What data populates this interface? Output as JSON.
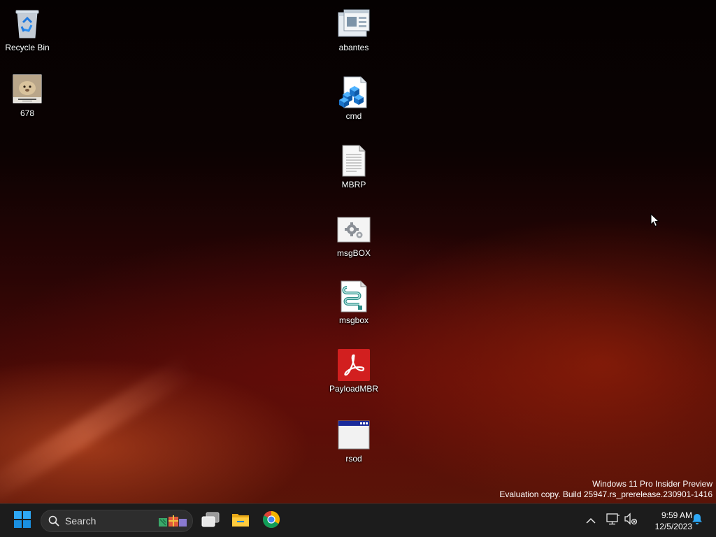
{
  "desktop": {
    "icons": [
      {
        "label": "Recycle Bin",
        "icon": "recycle-bin-icon"
      },
      {
        "label": "678",
        "icon": "image-file-icon"
      },
      {
        "label": "abantes",
        "icon": "application-window-icon"
      },
      {
        "label": "cmd",
        "icon": "registry-cubes-icon"
      },
      {
        "label": "MBRP",
        "icon": "text-document-icon"
      },
      {
        "label": "msgBOX",
        "icon": "settings-file-icon"
      },
      {
        "label": "msgbox",
        "icon": "script-file-icon"
      },
      {
        "label": "PayloadMBR",
        "icon": "pdf-file-icon"
      },
      {
        "label": "rsod",
        "icon": "app-window-icon"
      }
    ],
    "watermark": {
      "line1": "Windows 11 Pro Insider Preview",
      "line2": "Evaluation copy. Build 25947.rs_prerelease.230901-1416"
    }
  },
  "taskbar": {
    "start": "windows-start-icon",
    "search": {
      "placeholder": "Search",
      "icon": "search-icon"
    },
    "pinned": [
      "task-view-icon",
      "file-explorer-icon",
      "chrome-icon"
    ],
    "tray": [
      "chevron-up-icon",
      "network-icon",
      "volume-muted-icon",
      "notification-bell-icon"
    ],
    "clock": {
      "time": "9:59 AM",
      "date": "12/5/2023"
    }
  },
  "colors": {
    "taskbar": "#1c1c1c",
    "accent": "#0078d4"
  }
}
